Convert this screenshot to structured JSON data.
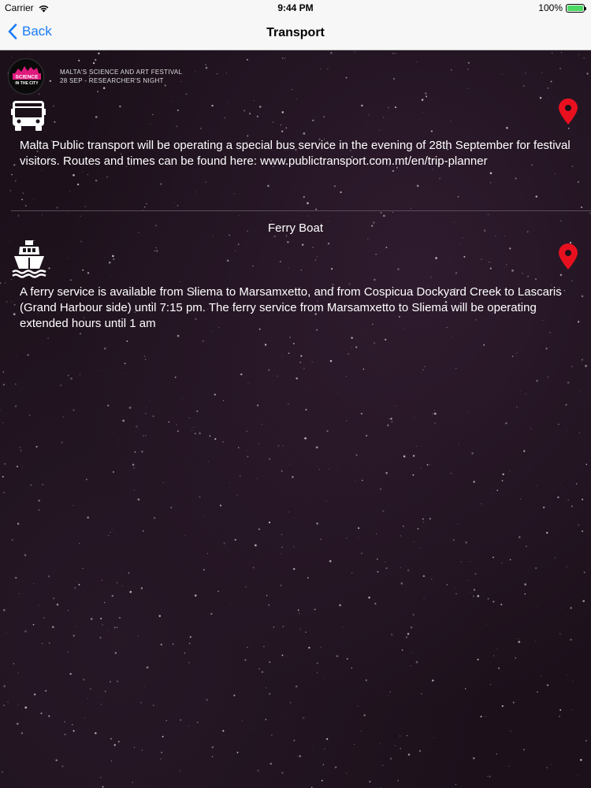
{
  "status_bar": {
    "carrier": "Carrier",
    "time": "9:44 PM",
    "battery": "100%"
  },
  "nav": {
    "back_label": "Back",
    "title": "Transport"
  },
  "festival": {
    "logo_line1": "SCIENCE",
    "logo_line2": "IN THE CITY",
    "line1": "MALTA'S SCIENCE AND ART FESTIVAL",
    "line2": "28 SEP - RESEARCHER'S NIGHT"
  },
  "sections": [
    {
      "title": "",
      "icon": "bus-icon",
      "description": "Malta Public transport will be operating a special bus service in the evening of 28th September for festival visitors. Routes and times can be found here: www.publictransport.com.mt/en/trip-planner"
    },
    {
      "title": "Ferry Boat",
      "icon": "ferry-icon",
      "description": "A ferry service is available from Sliema to Marsamxetto, and from Cospicua Dockyard Creek to Lascaris (Grand Harbour side) until 7:15 pm. The ferry service from Marsamxetto to Sliema will be operating extended hours until 1 am"
    }
  ],
  "colors": {
    "accent": "#1a7cf5",
    "pin": "#e8101f",
    "logo_pink": "#e0197d"
  }
}
